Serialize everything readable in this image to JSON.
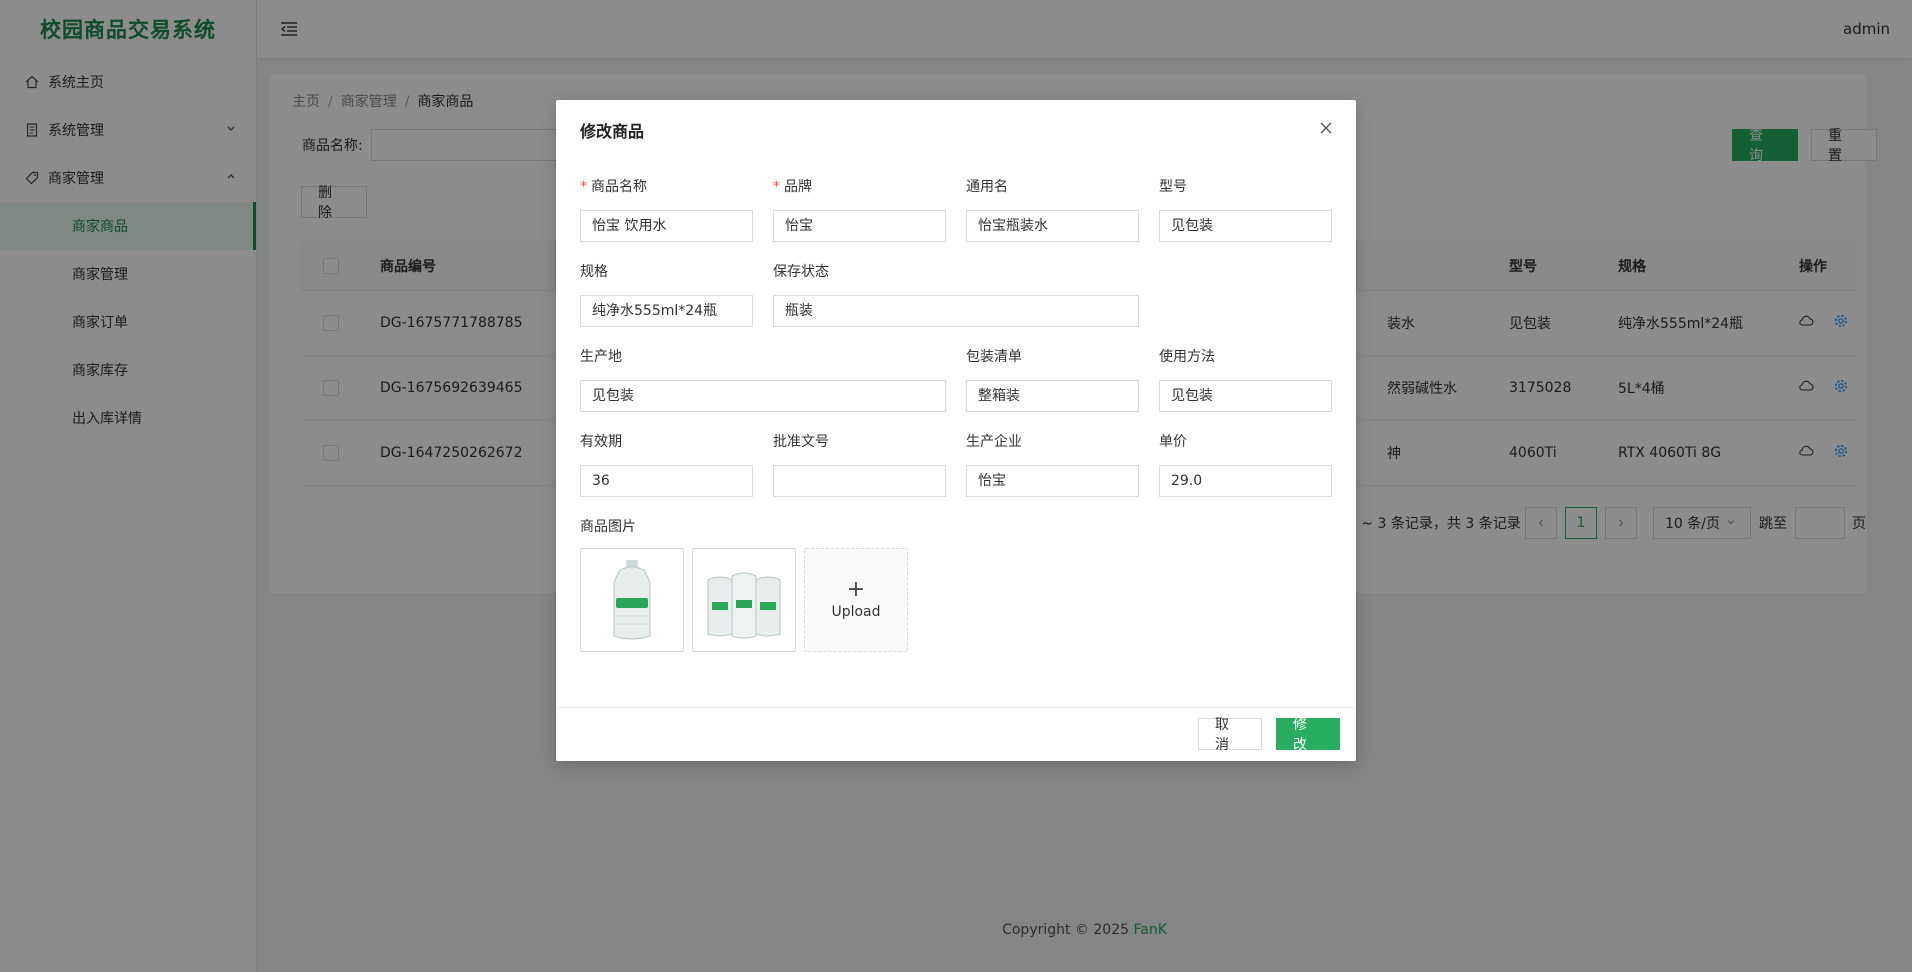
{
  "app": {
    "title": "校园商品交易系统",
    "user": "admin"
  },
  "sidebar": {
    "items": [
      {
        "label": "系统主页",
        "icon": "home-icon"
      },
      {
        "label": "系统管理",
        "icon": "document-icon",
        "arrow": "down"
      },
      {
        "label": "商家管理",
        "icon": "tag-icon",
        "arrow": "up"
      }
    ],
    "subitems": [
      "商家商品",
      "商家管理",
      "商家订单",
      "商家库存",
      "出入库详情"
    ]
  },
  "breadcrumb": [
    "主页",
    "商家管理",
    "商家商品"
  ],
  "search": {
    "label": "商品名称:",
    "value": ""
  },
  "buttons": {
    "query": "查 询",
    "reset": "重 置",
    "delete": "删 除"
  },
  "table": {
    "headers": {
      "id": "商品编号",
      "model": "型号",
      "spec": "规格",
      "action": "操作"
    },
    "rows": [
      {
        "id": "DG-1675771788785",
        "common_partial": "装水",
        "model": "见包装",
        "spec": "纯净水555ml*24瓶"
      },
      {
        "id": "DG-1675692639465",
        "common_partial": "然弱碱性水",
        "model": "3175028",
        "spec": "5L*4桶"
      },
      {
        "id": "DG-1647250262672",
        "common_partial": "神",
        "model": "4060Ti",
        "spec": "RTX 4060Ti 8G"
      }
    ]
  },
  "pagination": {
    "summary": "1 ~ 3 条记录，共 3 条记录",
    "current": "1",
    "page_size": "10 条/页",
    "jump_label": "跳至",
    "jump_suffix": "页",
    "jump_value": ""
  },
  "footer": {
    "text": "Copyright © 2025 ",
    "brand": "FanK"
  },
  "modal": {
    "title": "修改商品",
    "fields": {
      "name": {
        "label": "商品名称",
        "value": "怡宝 饮用水",
        "required": true
      },
      "brand": {
        "label": "品牌",
        "value": "怡宝",
        "required": true
      },
      "common_name": {
        "label": "通用名",
        "value": "怡宝瓶装水"
      },
      "model": {
        "label": "型号",
        "value": "见包装"
      },
      "spec": {
        "label": "规格",
        "value": "纯净水555ml*24瓶"
      },
      "storage": {
        "label": "保存状态",
        "value": "瓶装"
      },
      "origin": {
        "label": "生产地",
        "value": "见包装"
      },
      "packing": {
        "label": "包装清单",
        "value": "整箱装"
      },
      "usage": {
        "label": "使用方法",
        "value": "见包装"
      },
      "validity": {
        "label": "有效期",
        "value": "36"
      },
      "approval": {
        "label": "批准文号",
        "value": ""
      },
      "manufacturer": {
        "label": "生产企业",
        "value": "怡宝"
      },
      "price": {
        "label": "单价",
        "value": "29.0"
      }
    },
    "images_label": "商品图片",
    "upload_text": "Upload",
    "cancel": "取 消",
    "submit": "修 改"
  },
  "colors": {
    "accent": "#27ae60",
    "brand_title": "#1d8b4f",
    "required": "#ff4d4f"
  }
}
